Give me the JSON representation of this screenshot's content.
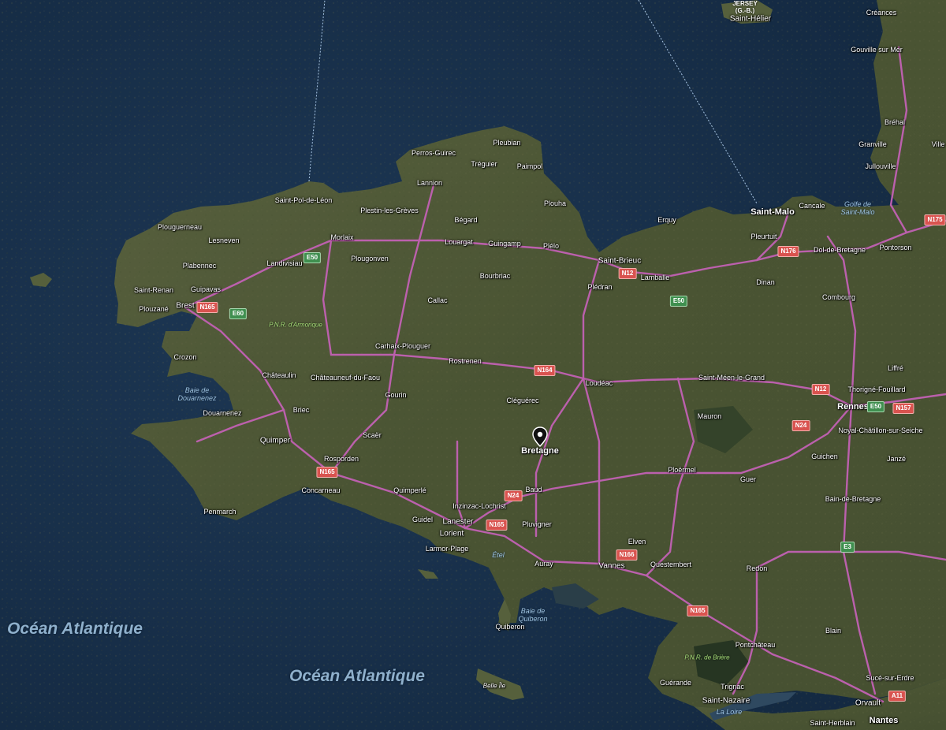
{
  "map": {
    "region_label": "Bretagne",
    "oceans": [
      "Océan Atlantique",
      "Océan Atlantique"
    ],
    "water_labels": {
      "douarnenez": [
        "Baie de",
        "Douarnenez"
      ],
      "quiberon": [
        "Baie de",
        "Quiberon"
      ],
      "saint_malo": [
        "Golfe de",
        "Saint-Malo"
      ],
      "etel": "Étel",
      "la_loire": "La Loire"
    },
    "islands": {
      "jersey": [
        "JERSEY",
        "(G.-B.)"
      ],
      "belle_ile": "Belle Île"
    },
    "parks": [
      "P.N.R. d'Armorique",
      "P.N.R. de Brière"
    ],
    "cities": {
      "saint_helier": "Saint-Hélier",
      "creances": "Créances",
      "gouville": "Gouville sur Mer",
      "brehal": "Bréhal",
      "granville": "Granville",
      "villedieu": "Ville",
      "jullouville": "Jullouville",
      "pleubian": "Pleubian",
      "perros": "Perros-Guirec",
      "treguier": "Tréguier",
      "paimpol": "Paimpol",
      "lannion": "Lannion",
      "saint_pol": "Saint-Pol-de-Léon",
      "plestin": "Plestin-les-Grèves",
      "plouha": "Plouha",
      "begard": "Bégard",
      "plouguerneau": "Plouguerneau",
      "lesneven": "Lesneven",
      "morlaix": "Morlaix",
      "louargat": "Louargat",
      "guingamp": "Guingamp",
      "plelo": "Plélo",
      "erquy": "Erquy",
      "saint_malo": "Saint-Malo",
      "cancale": "Cancale",
      "pleurtuit": "Pleurtuit",
      "plabennec": "Plabennec",
      "landivisiau": "Landivisiau",
      "plougonven": "Plougonven",
      "saint_brieuc": "Saint-Brieuc",
      "dol": "Dol-de-Bretagne",
      "pontorson": "Pontorson",
      "bourbriac": "Bourbriac",
      "lamballe": "Lamballe",
      "dinan": "Dinan",
      "saint_renan": "Saint-Renan",
      "guipavas": "Guipavas",
      "pledran": "Plédran",
      "brest": "Brest",
      "plouzane": "Plouzané",
      "callac": "Callac",
      "combourg": "Combourg",
      "crozon": "Crozon",
      "carhaix": "Carhaix-Plouguer",
      "rostrenen": "Rostrenen",
      "liffre": "Liffré",
      "chateaulin": "Châteaulin",
      "chateauneuf": "Châteauneuf-du-Faou",
      "saint_meen": "Saint-Méen-le-Grand",
      "loudeac": "Loudéac",
      "thorigne": "Thorigné-Fouillard",
      "gourin": "Gourin",
      "cleguerec": "Cléguérec",
      "briec": "Briec",
      "rennes": "Rennes",
      "douarnenez": "Douarnenez",
      "mauron": "Mauron",
      "noyal": "Noyal-Châtillon-sur-Seiche",
      "scaer": "Scaër",
      "quimper": "Quimper",
      "janze": "Janzé",
      "guichen": "Guichen",
      "rosporden": "Rosporden",
      "ploermel": "Ploërmel",
      "guer": "Guer",
      "concarneau": "Concarneau",
      "quimperle": "Quimperlé",
      "baud": "Baud",
      "bain": "Bain-de-Bretagne",
      "inzinzac": "Inzinzac-Lochrist",
      "penmarch": "Penmarch",
      "guidel": "Guidel",
      "lanester": "Lanester",
      "pluvigner": "Pluvigner",
      "lorient": "Lorient",
      "elven": "Elven",
      "larmor": "Larmor-Plage",
      "auray": "Auray",
      "vannes": "Vannes",
      "questembert": "Questembert",
      "redon": "Redon",
      "quiberon": "Quiberon",
      "blain": "Blain",
      "pontchateau": "Pontchâteau",
      "guerande": "Guérande",
      "suce": "Sucé-sur-Erdre",
      "trignac": "Trignac",
      "saint_nazaire": "Saint-Nazaire",
      "orvault": "Orvault",
      "saint_herblain": "Saint-Herblain",
      "nantes": "Nantes"
    },
    "shields": {
      "e50_a": "E50",
      "e50_b": "E50",
      "e50_c": "E50",
      "e60": "E60",
      "e3": "E3",
      "n165_a": "N165",
      "n165_b": "N165",
      "n165_c": "N165",
      "n165_d": "N165",
      "n166": "N166",
      "n164": "N164",
      "n12_a": "N12",
      "n12_b": "N12",
      "n24_a": "N24",
      "n24_b": "N24",
      "n157": "N157",
      "n176": "N176",
      "n175": "N175",
      "a11": "A11"
    },
    "colors": {
      "sea": "#1b3450",
      "land": "#4b5634",
      "roads": "#c261b4",
      "shield_national": "#d9534f",
      "shield_european": "#3f8f4f",
      "pin": "#111111"
    },
    "pin_icon": "map-pin-icon"
  }
}
